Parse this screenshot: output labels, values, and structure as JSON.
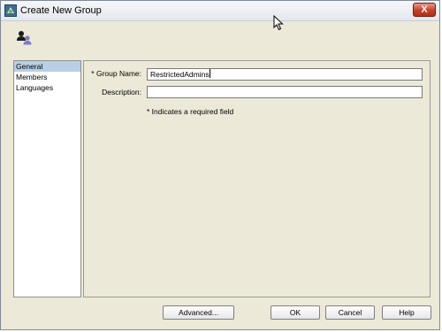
{
  "window": {
    "title": "Create New Group",
    "close_label": "X"
  },
  "toolbar": {
    "icon": "group-users-icon"
  },
  "nav": {
    "items": [
      {
        "label": "General",
        "selected": true
      },
      {
        "label": "Members",
        "selected": false
      },
      {
        "label": "Languages",
        "selected": false
      }
    ]
  },
  "form": {
    "group_name_label": "* Group Name:",
    "group_name_value": "RestrictedAdmins",
    "description_label": "Description:",
    "description_value": "",
    "required_note": "* Indicates a required field"
  },
  "buttons": {
    "advanced": "Advanced...",
    "ok": "OK",
    "cancel": "Cancel",
    "help": "Help"
  },
  "colors": {
    "window_bg": "#ece9d8",
    "selection": "#b8cfe5",
    "close_button": "#c4402a"
  }
}
